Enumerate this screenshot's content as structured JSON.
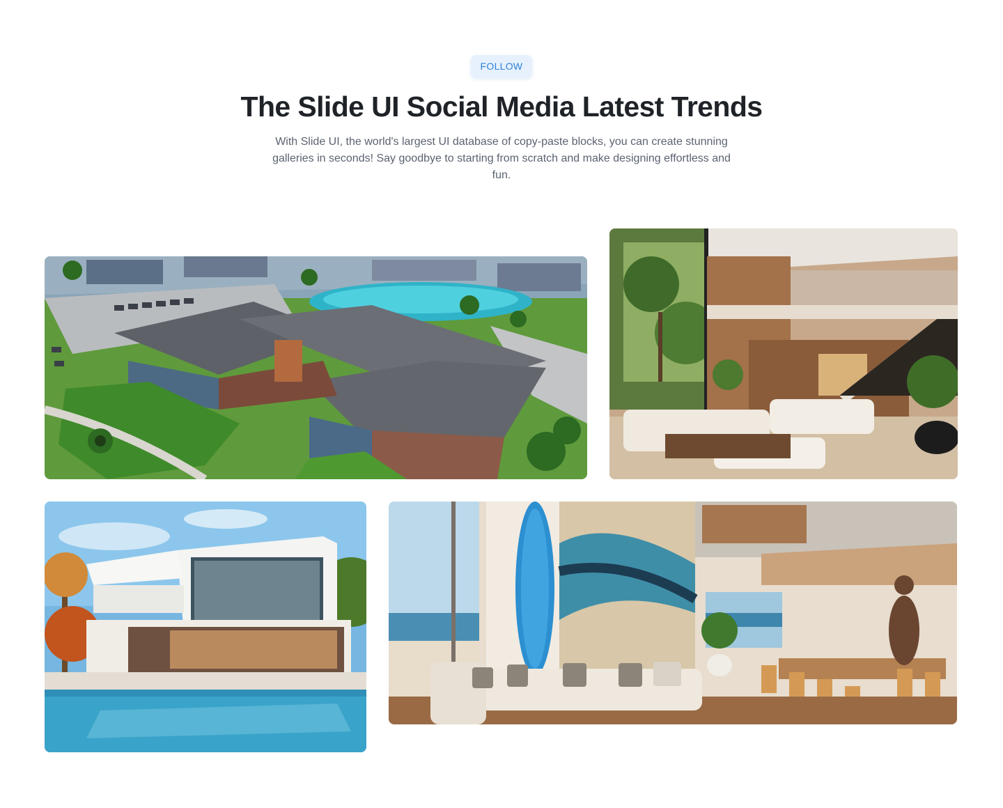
{
  "section": {
    "badge_label": "FOLLOW",
    "title": "The Slide UI Social Media Latest Trends",
    "description": "With Slide UI, the world's largest UI database of copy-paste blocks, you can create stunning galleries in seconds! Say goodbye to starting from scratch and make designing effortless and fun."
  },
  "colors": {
    "badge_bg": "#e6f1fd",
    "badge_text": "#2f80d9",
    "title": "#1f2328",
    "body_text": "#5b6270"
  },
  "gallery": {
    "images": [
      {
        "subject": "aerial-apartment-complex-with-pool"
      },
      {
        "subject": "modern-living-room-with-staircase"
      },
      {
        "subject": "modern-white-villa-with-pool"
      },
      {
        "subject": "beach-house-interior-with-surfboard"
      }
    ]
  }
}
